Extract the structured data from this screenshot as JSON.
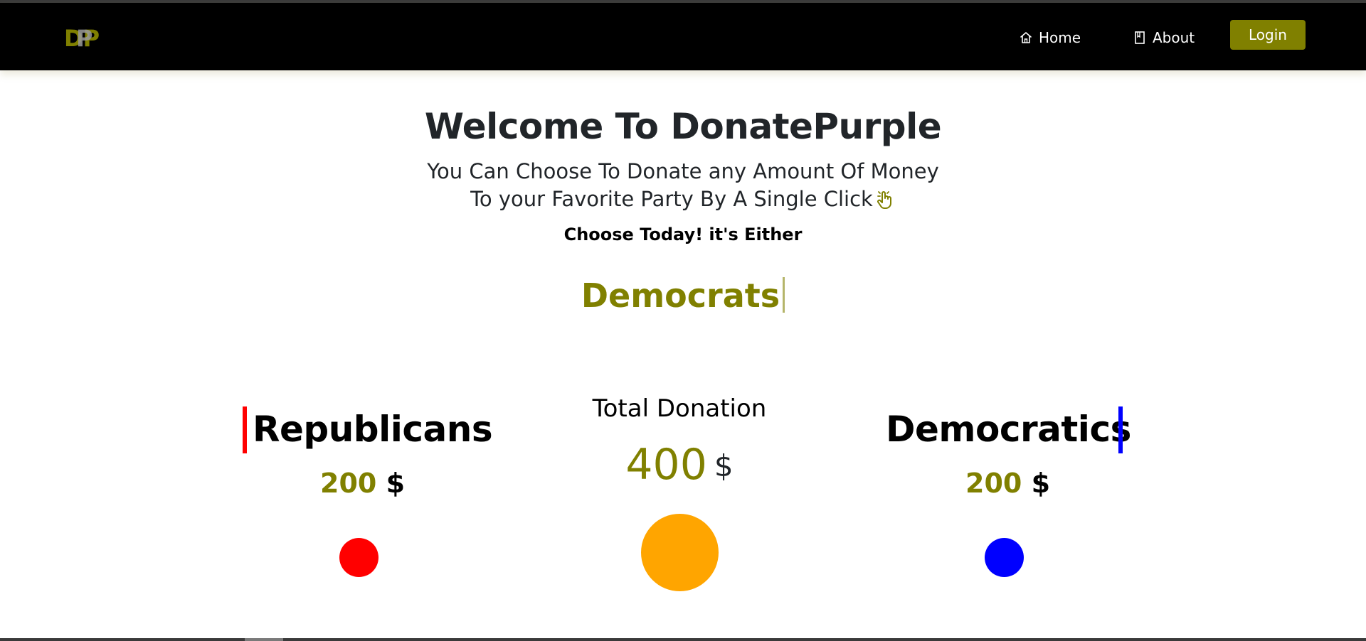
{
  "navbar": {
    "logo_text": "DP",
    "home_label": "Home",
    "about_label": "About",
    "login_label": "Login"
  },
  "hero": {
    "title": "Welcome To DonatePurple",
    "subtitle_line1": "You Can Choose To Donate any Amount Of Money",
    "subtitle_line2": "To your Favorite Party By A Single Click",
    "choose_text": "Choose Today! it's Either",
    "typed_text": "Democrats"
  },
  "donations": {
    "republicans": {
      "name": "Republicans",
      "amount": "200",
      "currency": "$",
      "color": "#ff0000"
    },
    "total": {
      "label": "Total Donation",
      "amount": "400",
      "currency": "$",
      "color": "#ffa500"
    },
    "democratics": {
      "name": "Democratics",
      "amount": "200",
      "currency": "$",
      "color": "#0000ff"
    }
  },
  "colors": {
    "accent": "#808000",
    "navbar": "#000000"
  },
  "icons": {
    "home": "home-icon",
    "about": "book-icon",
    "click": "hand-click-icon"
  }
}
